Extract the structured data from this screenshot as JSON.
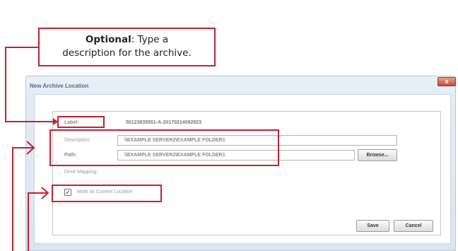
{
  "callout": {
    "strong": "Optional",
    "rest_line1": ": Type a",
    "line2": "description for the archive."
  },
  "dialog": {
    "title": "New Archive Location",
    "close_label": "x",
    "label_caption": "Label:",
    "label_value": "50123835551-A-20170214082923",
    "description_caption": "Description:",
    "description_value": "\\\\EXAMPLE SERVER2\\EXAMPLE FOLDER1",
    "path_caption": "Path:",
    "path_value": "\\\\EXAMPLE SERVER2\\EXAMPLE FOLDER1",
    "browse_label": "Browse...",
    "drive_mapping_caption": "Drive Mapping:",
    "current_location_label": "Mark as Current Location",
    "current_location_checked": true,
    "checkmark": "✓",
    "save_label": "Save",
    "cancel_label": "Cancel"
  },
  "colors": {
    "annotation_red": "#c8202d",
    "dialog_bg": "#dbe5f1",
    "title_text": "#556b86",
    "close_button": "#c74a33"
  }
}
